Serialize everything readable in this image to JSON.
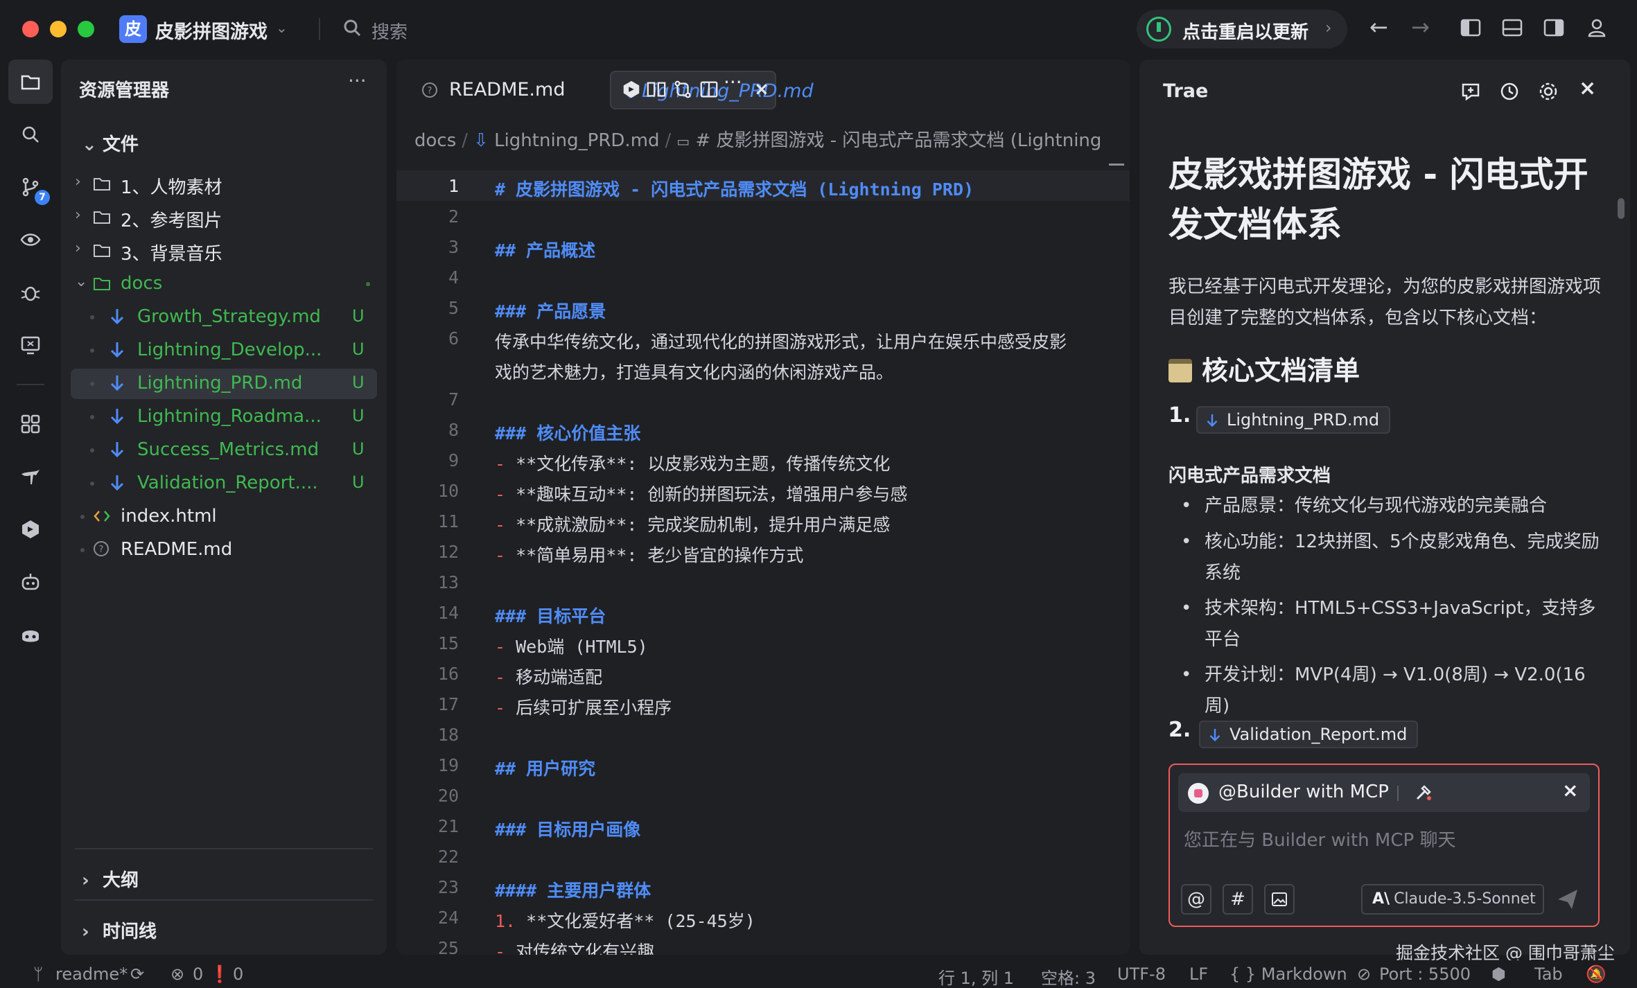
{
  "titlebar": {
    "project_icon": "皮",
    "project_name": "皮影拼图游戏",
    "search_placeholder": "搜索",
    "update_label": "点击重启以更新"
  },
  "explorer": {
    "title": "资源管理器",
    "more": "···",
    "section_files": "文件",
    "tree": [
      {
        "label": "1、人物素材",
        "type": "folder",
        "expanded": false,
        "status": ""
      },
      {
        "label": "2、参考图片",
        "type": "folder",
        "expanded": false,
        "status": ""
      },
      {
        "label": "3、背景音乐",
        "type": "folder",
        "expanded": false,
        "status": ""
      },
      {
        "label": "docs",
        "type": "folder",
        "expanded": true,
        "status": ""
      },
      {
        "label": "Growth_Strategy.md",
        "type": "md",
        "status": "U"
      },
      {
        "label": "Lightning_Develop...",
        "type": "md",
        "status": "U"
      },
      {
        "label": "Lightning_PRD.md",
        "type": "md",
        "status": "U",
        "selected": true
      },
      {
        "label": "Lightning_Roadma...",
        "type": "md",
        "status": "U"
      },
      {
        "label": "Success_Metrics.md",
        "type": "md",
        "status": "U"
      },
      {
        "label": "Validation_Report....",
        "type": "md",
        "status": "U"
      },
      {
        "label": "index.html",
        "type": "html",
        "status": ""
      },
      {
        "label": "README.md",
        "type": "readme",
        "status": ""
      }
    ],
    "section_outline": "大纲",
    "section_timeline": "时间线"
  },
  "activity": {
    "scm_badge": "7"
  },
  "editor": {
    "tabs": [
      {
        "label": "README.md",
        "active": false
      },
      {
        "label": "Lightning_PRD.md",
        "active": true
      }
    ],
    "tab_close": "×",
    "breadcrumb": {
      "folder": "docs",
      "file": "Lightning_PRD.md",
      "symbol": "# 皮影拼图游戏 - 闪电式产品需求文档 (Lightning"
    },
    "lines": [
      {
        "n": "1",
        "kind": "h",
        "text": "# 皮影拼图游戏 - 闪电式产品需求文档 (Lightning PRD)"
      },
      {
        "n": "2",
        "kind": "blank",
        "text": ""
      },
      {
        "n": "3",
        "kind": "h",
        "text": "## 产品概述"
      },
      {
        "n": "4",
        "kind": "blank",
        "text": ""
      },
      {
        "n": "5",
        "kind": "h",
        "text": "### 产品愿景"
      },
      {
        "n": "6",
        "kind": "p",
        "text": "传承中华传统文化，通过现代化的拼图游戏形式，让用户在娱乐中感受皮影"
      },
      {
        "n": "",
        "kind": "p",
        "text": "戏的艺术魅力，打造具有文化内涵的休闲游戏产品。"
      },
      {
        "n": "7",
        "kind": "blank",
        "text": ""
      },
      {
        "n": "8",
        "kind": "h",
        "text": "### 核心价值主张"
      },
      {
        "n": "9",
        "kind": "li",
        "text": "**文化传承**: 以皮影戏为主题，传播传统文化"
      },
      {
        "n": "10",
        "kind": "li",
        "text": "**趣味互动**: 创新的拼图玩法，增强用户参与感"
      },
      {
        "n": "11",
        "kind": "li",
        "text": "**成就激励**: 完成奖励机制，提升用户满足感"
      },
      {
        "n": "12",
        "kind": "li",
        "text": "**简单易用**: 老少皆宜的操作方式"
      },
      {
        "n": "13",
        "kind": "blank",
        "text": ""
      },
      {
        "n": "14",
        "kind": "h",
        "text": "### 目标平台"
      },
      {
        "n": "15",
        "kind": "li",
        "text": "Web端 (HTML5)"
      },
      {
        "n": "16",
        "kind": "li",
        "text": "移动端适配"
      },
      {
        "n": "17",
        "kind": "li",
        "text": "后续可扩展至小程序"
      },
      {
        "n": "18",
        "kind": "blank",
        "text": ""
      },
      {
        "n": "19",
        "kind": "h",
        "text": "## 用户研究"
      },
      {
        "n": "20",
        "kind": "blank",
        "text": ""
      },
      {
        "n": "21",
        "kind": "h",
        "text": "### 目标用户画像"
      },
      {
        "n": "22",
        "kind": "blank",
        "text": ""
      },
      {
        "n": "23",
        "kind": "h",
        "text": "#### 主要用户群体"
      },
      {
        "n": "24",
        "kind": "ol",
        "text": "**文化爱好者** (25-45岁)"
      },
      {
        "n": "25",
        "kind": "sub",
        "text": "对传统文化有兴趣"
      }
    ]
  },
  "chat": {
    "title": "Trae",
    "heading": "皮影戏拼图游戏 - 闪电式开发文档体系",
    "intro": "我已经基于闪电式开发理论，为您的皮影戏拼图游戏项目创建了完整的文档体系，包含以下核心文档：",
    "list_heading": "核心文档清单",
    "doc1": {
      "num": "1.",
      "file": "Lightning_PRD.md",
      "subtitle": "闪电式产品需求文档"
    },
    "bullets": [
      "产品愿景：传统文化与现代游戏的完美融合",
      "核心功能：12块拼图、5个皮影戏角色、完成奖励系统",
      "技术架构：HTML5+CSS3+JavaScript，支持多平台",
      "开发计划：MVP(4周) → V1.0(8周) → V2.0(16周)"
    ],
    "doc2": {
      "num": "2.",
      "file": "Validation_Report.md"
    },
    "input": {
      "agent": "@Builder with MCP",
      "placeholder": "您正在与 Builder with MCP 聊天",
      "at": "@",
      "hash": "#",
      "model": "Claude-3.5-Sonnet",
      "model_logo": "A\\"
    }
  },
  "statusbar": {
    "branch": "readme*",
    "errors": "0",
    "warnings": "0",
    "position": "行 1, 列 1",
    "spaces": "空格: 3",
    "encoding": "UTF-8",
    "eol": "LF",
    "language": "{ } Markdown",
    "port": "Port : 5500",
    "tab": "Tab"
  },
  "watermark": "掘金技术社区 @ 围巾哥萧尘"
}
